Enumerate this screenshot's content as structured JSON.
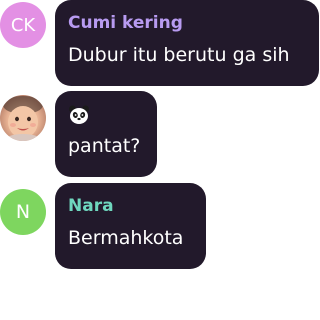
{
  "messages": [
    {
      "sender": "Cumi kering",
      "avatar_initials": "CK",
      "avatar_color": "#e390e4",
      "name_color": "#b89bf1",
      "text": "Dubur itu berutu ga sih"
    },
    {
      "sender": "",
      "avatar_type": "photo",
      "sticker_icon": "panda-icon",
      "text": "pantat?"
    },
    {
      "sender": "Nara",
      "avatar_initials": "N",
      "avatar_color": "#7ed65f",
      "name_color": "#6fd7be",
      "text": "Bermahkota"
    }
  ]
}
